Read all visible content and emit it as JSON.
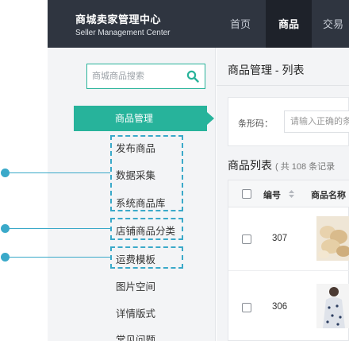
{
  "header": {
    "brand_cn": "商城卖家管理中心",
    "brand_en": "Seller Management Center",
    "nav": [
      {
        "label": "首页",
        "active": false
      },
      {
        "label": "商品",
        "active": true
      },
      {
        "label": "交易",
        "active": false
      }
    ],
    "colors": {
      "bar": "#2f3540",
      "active_tab": "#1e222a"
    }
  },
  "sidebar": {
    "search_placeholder": "商城商品搜索",
    "active_menu": "商品管理",
    "items": [
      {
        "label": "发布商品"
      },
      {
        "label": "数据采集"
      },
      {
        "label": "系统商品库"
      },
      {
        "label": "店铺商品分类"
      },
      {
        "label": "运费模板"
      },
      {
        "label": "图片空间"
      },
      {
        "label": "详情版式"
      },
      {
        "label": "常见问题"
      }
    ],
    "accent": "#27b39b",
    "highlight_color": "#3aa9c9"
  },
  "main": {
    "page_title": "商品管理 - 列表",
    "filter": {
      "barcode_label": "条形码：",
      "barcode_placeholder": "请输入正确的条"
    },
    "list_title": "商品列表",
    "list_count": "( 共 108 条记录",
    "table": {
      "columns": [
        "编号",
        "商品名称"
      ],
      "rows": [
        {
          "id": "307"
        },
        {
          "id": "306"
        }
      ]
    }
  }
}
